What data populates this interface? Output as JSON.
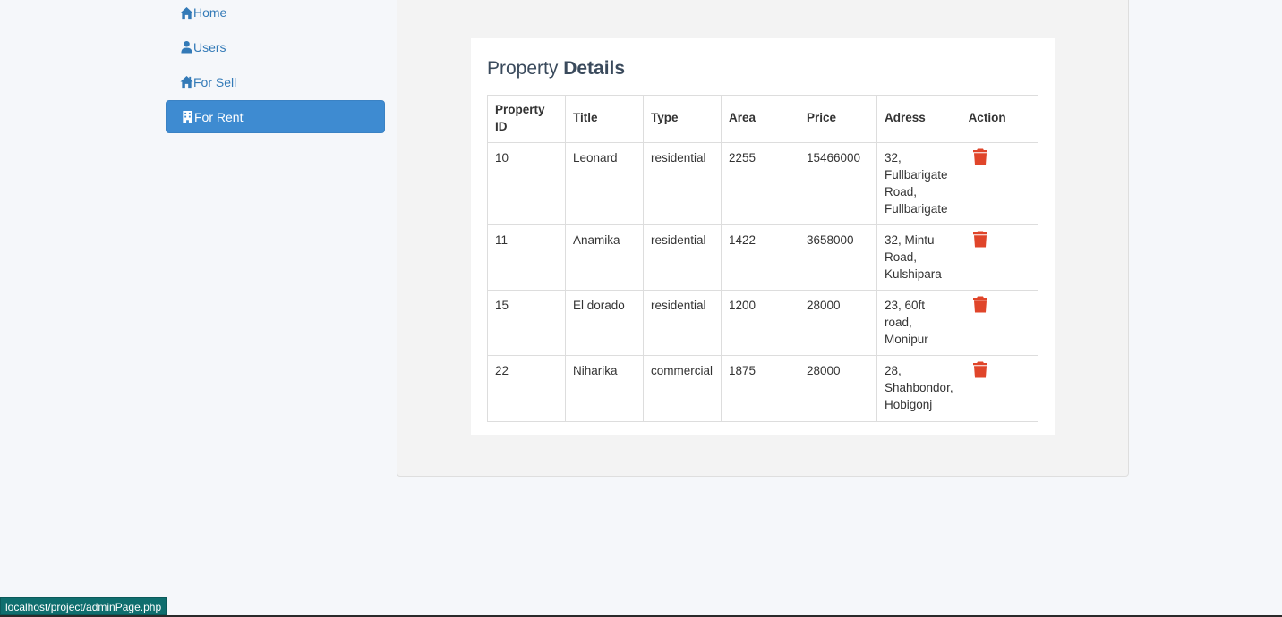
{
  "sidebar": {
    "items": [
      {
        "label": "Home",
        "icon": "home-icon",
        "active": false
      },
      {
        "label": "Users",
        "icon": "user-icon",
        "active": false
      },
      {
        "label": "For Sell",
        "icon": "house-icon",
        "active": false
      },
      {
        "label": "For Rent",
        "icon": "building-icon",
        "active": true
      }
    ]
  },
  "main": {
    "title_light": "Property ",
    "title_bold": "Details",
    "table": {
      "headers": [
        "Property ID",
        "Title",
        "Type",
        "Area",
        "Price",
        "Adress",
        "Action"
      ],
      "rows": [
        {
          "id": "10",
          "title": "Leonard",
          "type": "residential",
          "area": "2255",
          "price": "15466000",
          "address": "32, Fullbarigate Road, Fullbarigate"
        },
        {
          "id": "11",
          "title": "Anamika",
          "type": "residential",
          "area": "1422",
          "price": "3658000",
          "address": "32, Mintu Road, Kulshipara"
        },
        {
          "id": "15",
          "title": "El dorado",
          "type": "residential",
          "area": "1200",
          "price": "28000",
          "address": "23, 60ft road, Monipur"
        },
        {
          "id": "22",
          "title": "Niharika",
          "type": "commercial",
          "area": "1875",
          "price": "28000",
          "address": "28, Shahbondor, Hobigonj"
        }
      ]
    }
  },
  "status_bar": {
    "url": "localhost/project/adminPage.php"
  },
  "colors": {
    "link": "#337ab7",
    "active_bg": "#3e8bd1",
    "trash": "#e0452a"
  }
}
